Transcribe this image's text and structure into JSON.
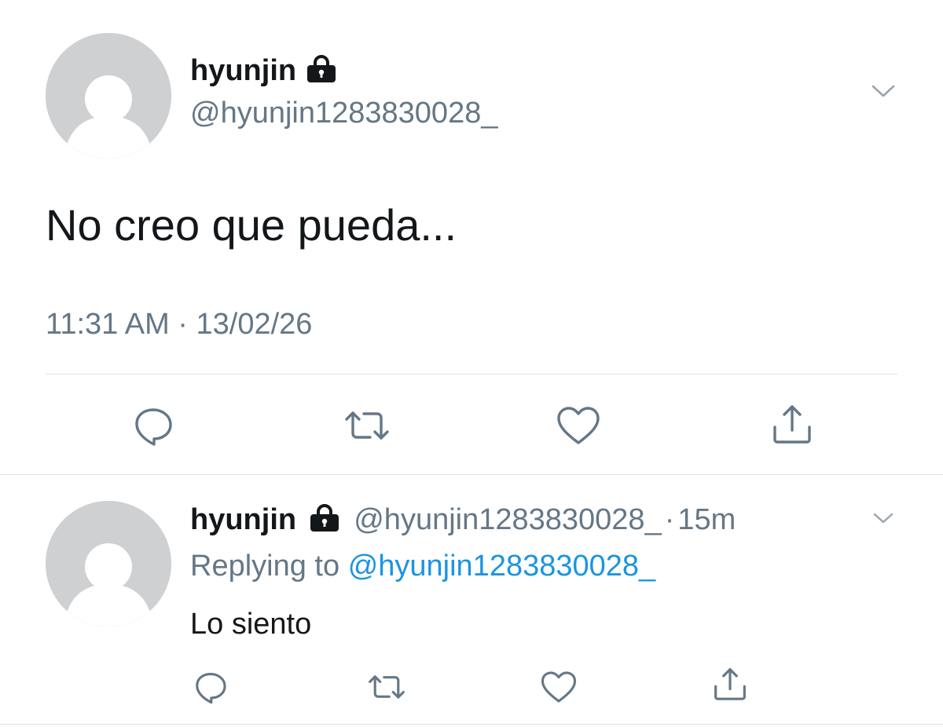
{
  "main_tweet": {
    "display_name": "hyunjin",
    "handle": "@hyunjin1283830028_",
    "text": "No creo que pueda...",
    "timestamp": "11:31 AM · 13/02/26",
    "lock_icon": "lock-icon",
    "menu_icon": "chevron-down-icon"
  },
  "reply_tweet": {
    "display_name": "hyunjin",
    "handle": "@hyunjin1283830028_",
    "separator": "·",
    "age": "15m",
    "replying_prefix": "Replying to",
    "replying_to": "@hyunjin1283830028_",
    "text": "Lo siento",
    "lock_icon": "lock-icon",
    "menu_icon": "chevron-down-icon"
  },
  "actions": [
    {
      "icon": "reply-icon"
    },
    {
      "icon": "retweet-icon"
    },
    {
      "icon": "like-icon"
    },
    {
      "icon": "share-icon"
    }
  ],
  "colors": {
    "text_primary": "#14171a",
    "text_secondary": "#657786",
    "link": "#1b95e0",
    "icon": "#657786",
    "avatar_bg": "#cfd0d2",
    "divider": "#dde2e6"
  }
}
